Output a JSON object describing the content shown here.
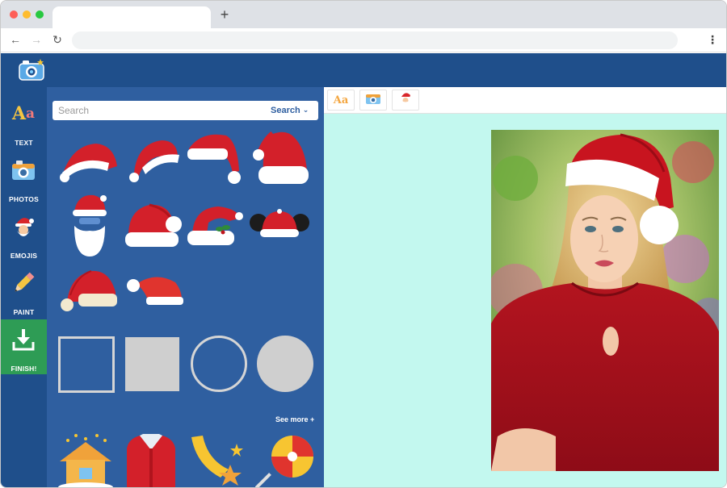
{
  "sidebar": {
    "items": [
      {
        "label": "TEXT",
        "icon": "text-aa-icon"
      },
      {
        "label": "PHOTOS",
        "icon": "camera-icon"
      },
      {
        "label": "EMOJIS",
        "icon": "santa-emoji-icon"
      },
      {
        "label": "PAINT",
        "icon": "pencil-icon"
      },
      {
        "label": "FINISH!",
        "icon": "download-icon"
      }
    ]
  },
  "search": {
    "placeholder": "Search",
    "button_label": "Search"
  },
  "panel": {
    "see_more_label": "See more +"
  },
  "toolbar": {
    "text_glyph": "Aa"
  },
  "colors": {
    "header": "#1f4f8b",
    "panel": "#2f5fa0",
    "finish": "#2e9c55",
    "canvas_bg": "#c3f8ef"
  }
}
